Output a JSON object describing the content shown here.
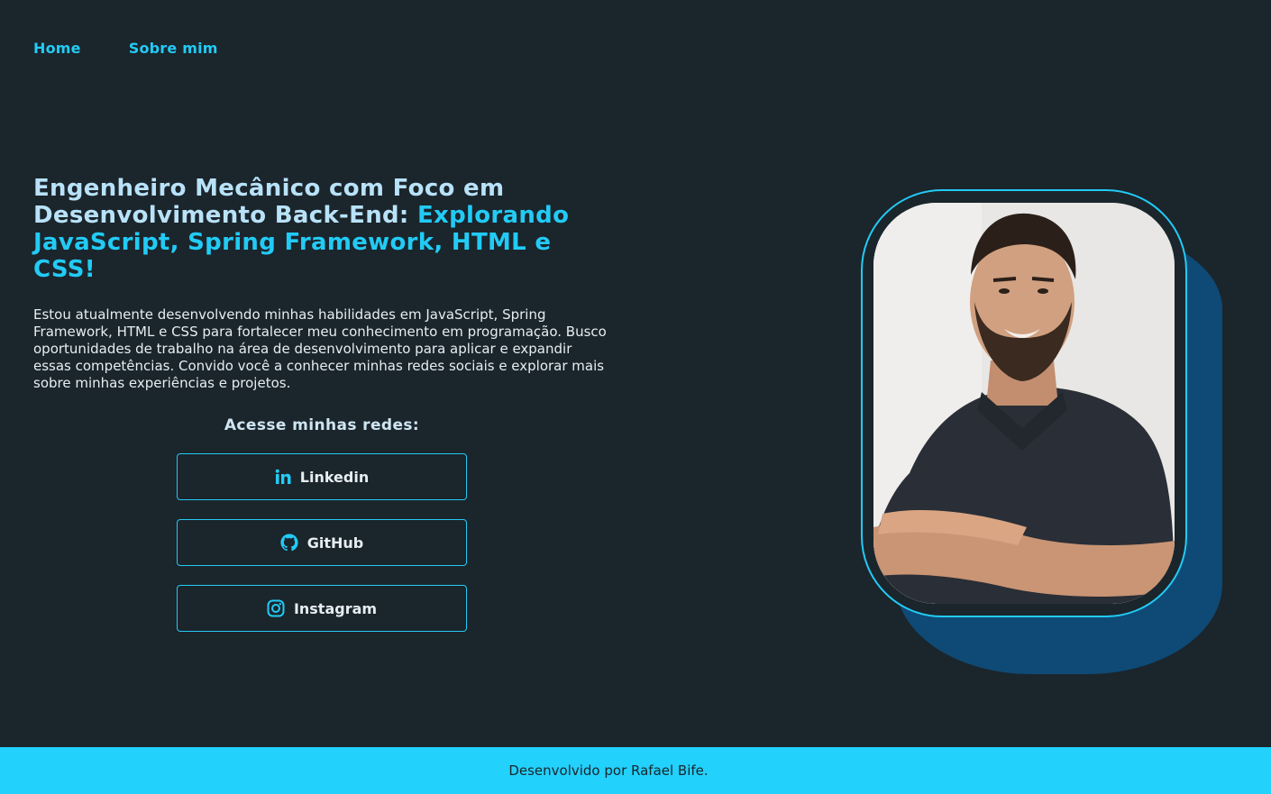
{
  "nav": {
    "home": "Home",
    "about": "Sobre mim"
  },
  "hero": {
    "headline_part1": "Engenheiro Mecânico com Foco em Desenvolvimento Back-End: ",
    "headline_part2": "Explorando JavaScript, Spring Framework, HTML e CSS!",
    "intro": "Estou atualmente desenvolvendo minhas habilidades em JavaScript, Spring Framework, HTML e CSS para fortalecer meu conhecimento em programação. Busco oportunidades de trabalho na área de desenvolvimento para aplicar e expandir essas competências. Convido você a conhecer minhas redes sociais e explorar mais sobre minhas experiências e projetos."
  },
  "social": {
    "title": "Acesse minhas redes:",
    "links": [
      {
        "label": "Linkedin",
        "icon": "linkedin-icon"
      },
      {
        "label": "GitHub",
        "icon": "github-icon"
      },
      {
        "label": "Instagram",
        "icon": "instagram-icon"
      }
    ]
  },
  "photo": {
    "alt": "profile-photo"
  },
  "footer": {
    "text": "Desenvolvido por Rafael Bife."
  },
  "colors": {
    "background": "#1b252c",
    "accent": "#22cbf5",
    "headline": "#b8e2f8",
    "photo_shadow": "#0e4a75",
    "footer": "#22d1fc"
  }
}
